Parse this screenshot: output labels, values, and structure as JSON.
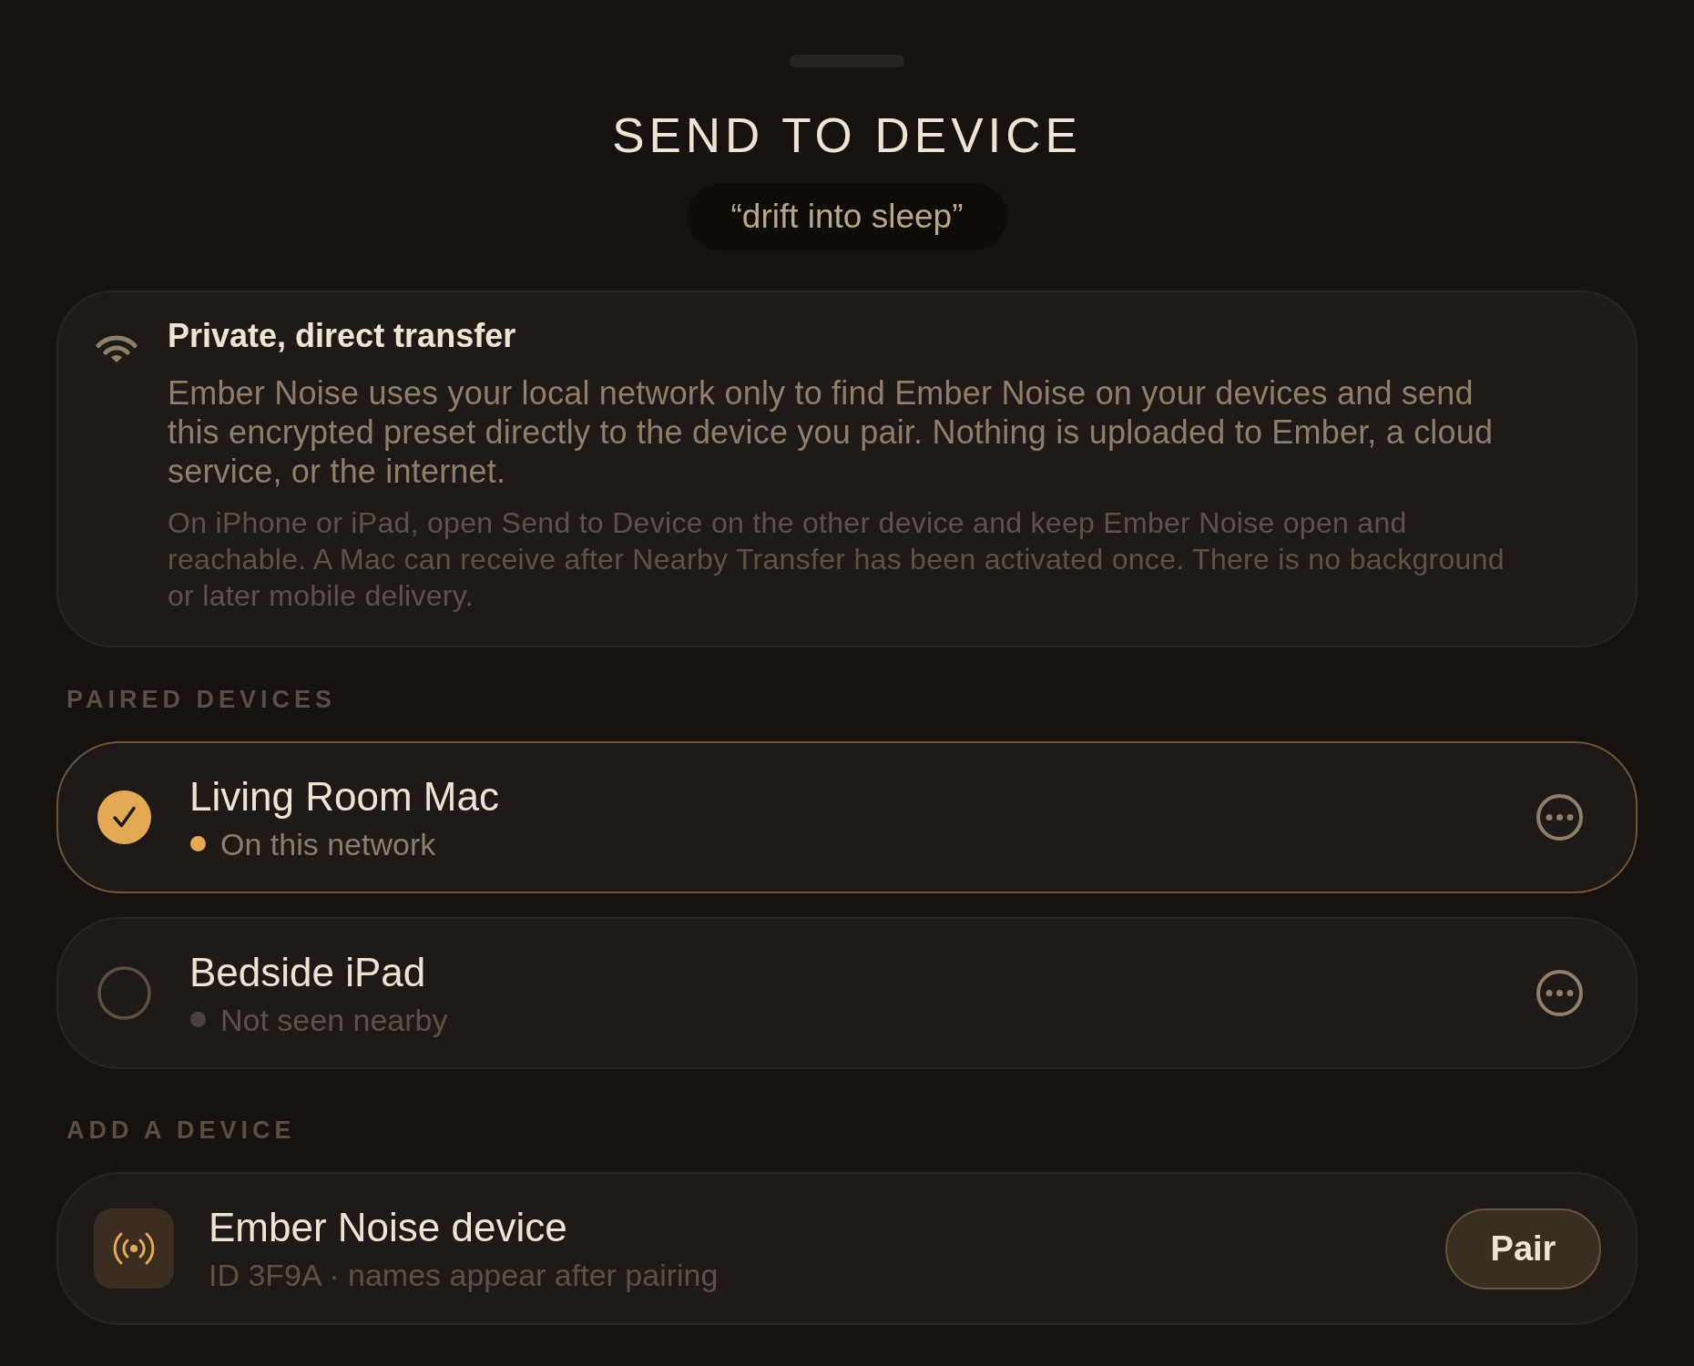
{
  "sheet": {
    "title": "SEND TO DEVICE",
    "preset_name": "“drift into sleep”"
  },
  "info": {
    "title": "Private, direct transfer",
    "body": "Ember Noise uses your local network only to find Ember Noise on your devices and send this encrypted preset directly to the device you pair. Nothing is uploaded to Ember, a cloud service, or the internet.",
    "note": "On iPhone or iPad, open Send to Device on the other device and keep Ember Noise open and reachable. A Mac can receive after Nearby Transfer has been activated once. There is no background or later mobile delivery."
  },
  "paired_devices": {
    "heading": "PAIRED DEVICES",
    "items": [
      {
        "name": "Living Room Mac",
        "status": "On this network",
        "nearby": true,
        "color": "#e3a955",
        "selected": true
      },
      {
        "name": "Bedside iPad",
        "status": "Not seen nearby",
        "nearby": false,
        "color": "#4a413a",
        "selected": false
      }
    ]
  },
  "add_device": {
    "heading": "ADD A DEVICE",
    "items": [
      {
        "name": "Ember Noise device",
        "detail": "ID 3F9A · names appear after pairing",
        "button": "Pair"
      }
    ]
  }
}
